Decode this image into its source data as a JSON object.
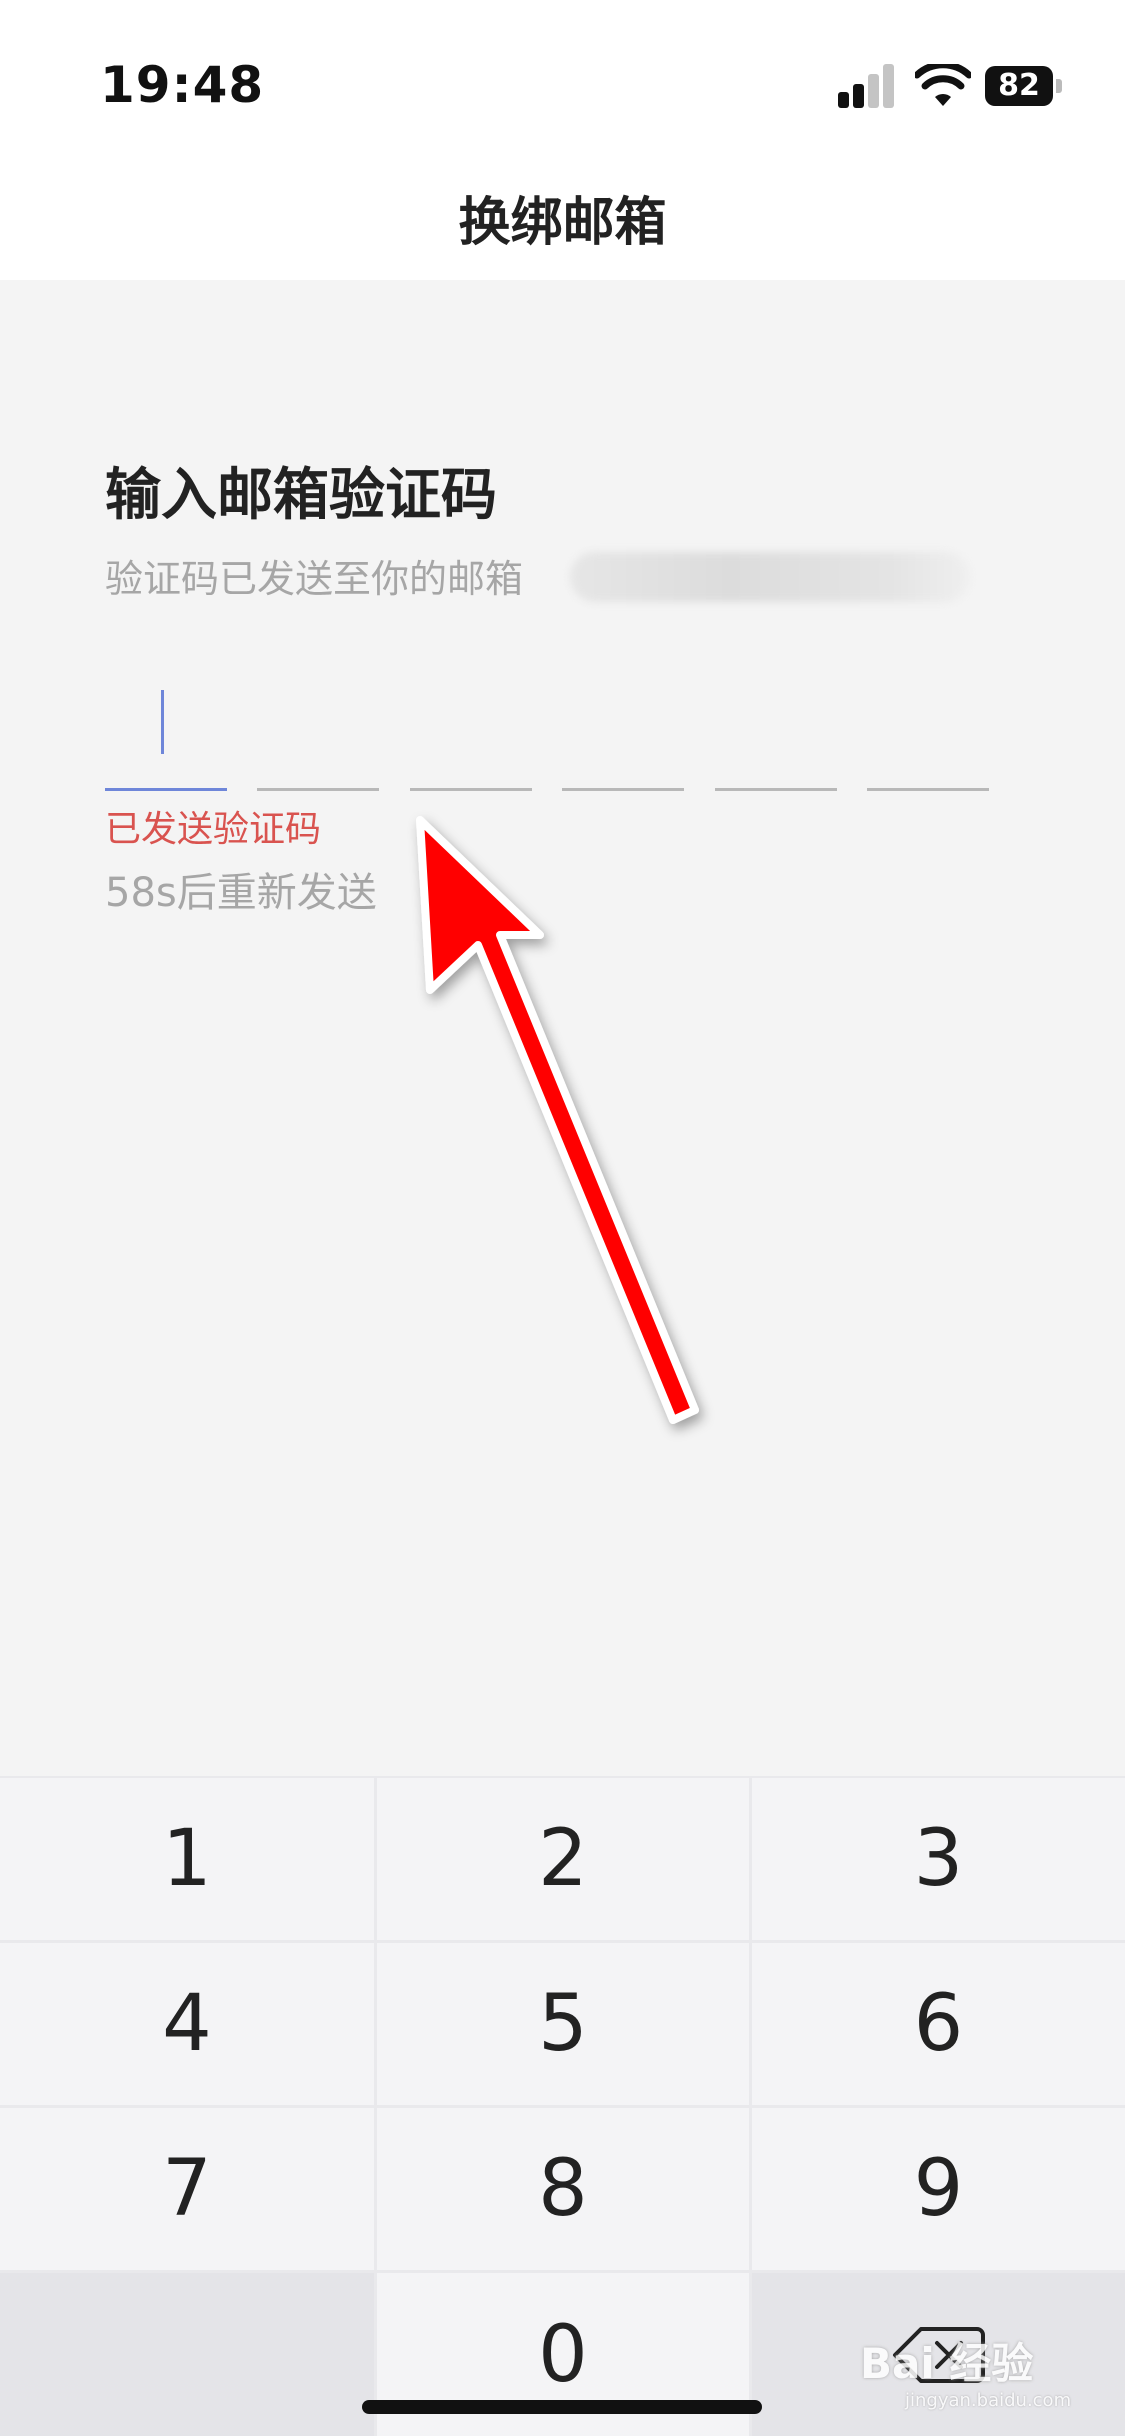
{
  "status_bar": {
    "time": "19:48",
    "battery": "82"
  },
  "nav": {
    "title": "换绑邮箱"
  },
  "content": {
    "heading": "输入邮箱验证码",
    "subtitle": "验证码已发送至你的邮箱",
    "code_length": 6,
    "sent_status": "已发送验证码",
    "resend_countdown": "58s后重新发送"
  },
  "keypad": {
    "keys": [
      "1",
      "2",
      "3",
      "4",
      "5",
      "6",
      "7",
      "8",
      "9",
      "",
      "0",
      "⌫"
    ]
  },
  "watermark": {
    "text": "Bai 经验",
    "sub": "jingyan.baidu.com"
  },
  "colors": {
    "accent": "#6e86d9",
    "error": "#d9534f",
    "arrow": "#ff0000"
  },
  "icons": {
    "backspace": "backspace-icon",
    "signal": "signal-icon",
    "wifi": "wifi-icon",
    "battery": "battery-icon"
  }
}
